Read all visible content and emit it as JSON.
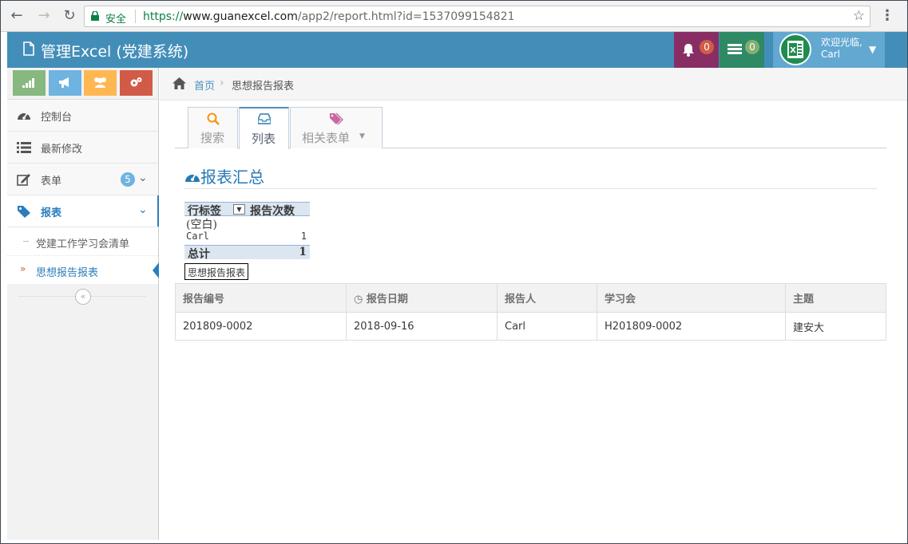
{
  "browser": {
    "secure_label": "安全",
    "url_scheme": "https://",
    "url_host": "www.guanexcel.com",
    "url_path": "/app2/report.html?id=1537099154821"
  },
  "navbar": {
    "brand": "管理Excel (党建系统)",
    "notifications_count": "0",
    "tasks_count": "0",
    "welcome": "欢迎光临,",
    "user_name": "Carl"
  },
  "sidebar": {
    "menu": [
      {
        "label": "控制台",
        "icon": "dashboard-icon"
      },
      {
        "label": "最新修改",
        "icon": "list-icon"
      },
      {
        "label": "表单",
        "icon": "edit-icon",
        "badge": "5"
      },
      {
        "label": "报表",
        "icon": "tag-icon"
      }
    ],
    "report_sub": [
      {
        "label": "党建工作学习会清单"
      },
      {
        "label": "思想报告报表"
      }
    ]
  },
  "breadcrumb": {
    "home": "首页",
    "current": "思想报告报表"
  },
  "tabs": [
    {
      "label": "搜索",
      "icon": "search-icon"
    },
    {
      "label": "列表",
      "icon": "inbox-icon"
    },
    {
      "label": "相关表单",
      "icon": "tags-icon"
    }
  ],
  "section_title": "报表汇总",
  "pivot": {
    "header_row_label": "行标签",
    "header_value": "报告次数",
    "rows": [
      {
        "label": "(空白)",
        "value": ""
      },
      {
        "label": "Carl",
        "value": "1"
      }
    ],
    "total_label": "总计",
    "total_value": "1",
    "sheet_tab": "思想报告报表"
  },
  "table": {
    "headers": [
      "报告编号",
      "报告日期",
      "报告人",
      "学习会",
      "主题"
    ],
    "rows": [
      [
        "201809-0002",
        "2018-09-16",
        "Carl",
        "H201809-0002",
        "建安大"
      ]
    ]
  },
  "colors": {
    "navbar": "#438eb9",
    "notifications": "#892e65",
    "tasks": "#2e8965",
    "user": "#62a8d1",
    "link": "#4c8fbd"
  }
}
